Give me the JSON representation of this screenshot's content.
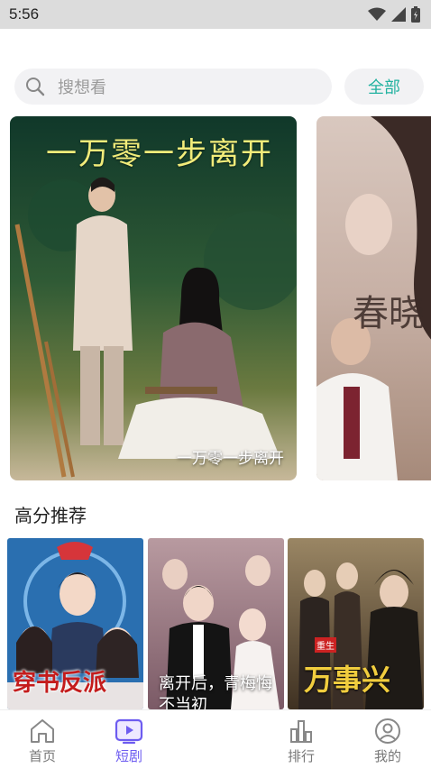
{
  "status_bar": {
    "time": "5:56"
  },
  "search": {
    "placeholder": "搜想看",
    "all_label": "全部"
  },
  "banners": [
    {
      "title": "一万零一步离开",
      "caption": "一万零一步离开"
    },
    {
      "title": "春晓"
    }
  ],
  "section": {
    "title": "高分推荐"
  },
  "recommendations": [
    {
      "title": "穿书反派"
    },
    {
      "title": "离开后，青梅悔不当初"
    },
    {
      "title": "万事兴",
      "tag": "重生"
    }
  ],
  "tabbar": {
    "items": [
      {
        "label": "首页",
        "icon": "home-icon",
        "active": false
      },
      {
        "label": "短剧",
        "icon": "play-icon",
        "active": true
      },
      {
        "label": "排行",
        "icon": "chart-icon",
        "active": false
      },
      {
        "label": "我的",
        "icon": "profile-icon",
        "active": false
      }
    ]
  },
  "colors": {
    "accent": "#6d5cf0",
    "all_button_text": "#22b2a0"
  }
}
